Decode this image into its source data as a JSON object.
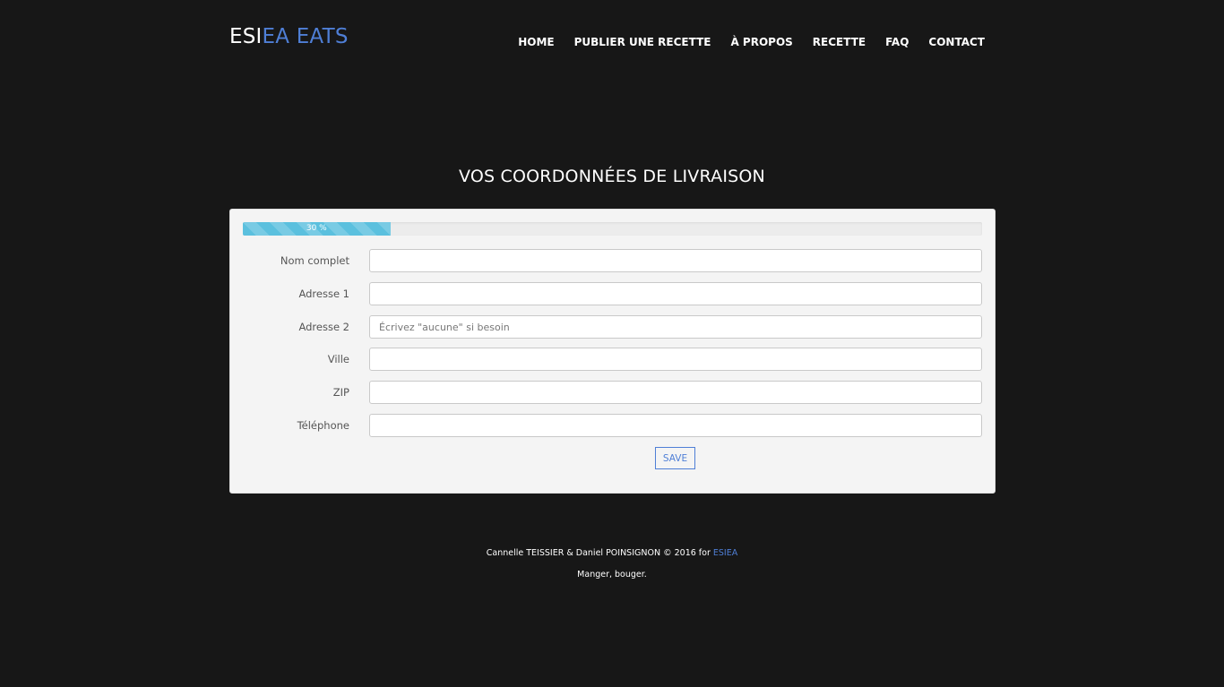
{
  "header": {
    "logo_part1": "ESI",
    "logo_part2": "EA EATS",
    "nav": [
      "HOME",
      "PUBLIER UNE RECETTE",
      "À PROPOS",
      "RECETTE",
      "FAQ",
      "CONTACT"
    ]
  },
  "main": {
    "title": "VOS COORDONNÉES DE LIVRAISON",
    "progress": {
      "percent": 30,
      "label": "30 %",
      "color": "#5bc0de"
    },
    "fields": [
      {
        "label": "Nom complet",
        "value": "",
        "placeholder": ""
      },
      {
        "label": "Adresse 1",
        "value": "",
        "placeholder": ""
      },
      {
        "label": "Adresse 2",
        "value": "",
        "placeholder": "Écrivez \"aucune\" si besoin"
      },
      {
        "label": "Ville",
        "value": "",
        "placeholder": ""
      },
      {
        "label": "ZIP",
        "value": "",
        "placeholder": ""
      },
      {
        "label": "Téléphone",
        "value": "",
        "placeholder": ""
      }
    ],
    "save_label": "SAVE"
  },
  "footer": {
    "credit": "Cannelle TEISSIER & Daniel POINSIGNON © 2016 for ",
    "link": "ESIEA",
    "tagline": "Manger, bouger."
  },
  "colors": {
    "background": "#171717",
    "accent": "#4f7fd6",
    "panel": "#f4f4f4"
  }
}
